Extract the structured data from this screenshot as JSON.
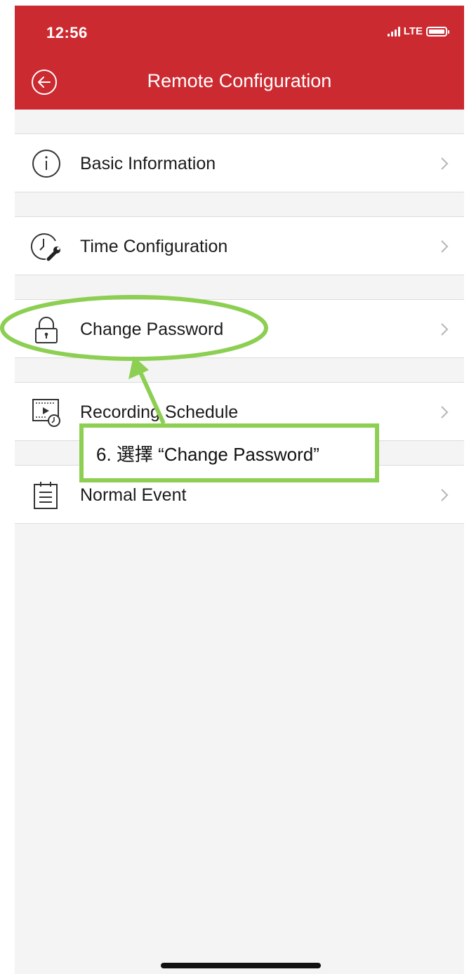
{
  "status_bar": {
    "time": "12:56",
    "network": "LTE"
  },
  "header": {
    "title": "Remote Configuration"
  },
  "menu": {
    "items": [
      {
        "label": "Basic Information",
        "icon": "info-icon"
      },
      {
        "label": "Time Configuration",
        "icon": "time-wrench-icon"
      },
      {
        "label": "Change Password",
        "icon": "lock-icon"
      },
      {
        "label": "Recording Schedule",
        "icon": "recording-schedule-icon"
      },
      {
        "label": "Normal Event",
        "icon": "event-list-icon"
      }
    ]
  },
  "annotation": {
    "text": "6. 選擇 “Change Password”"
  },
  "colors": {
    "header_bg": "#cc2a31",
    "annotation_green": "#8ccf52",
    "page_bg": "#f4f4f4"
  }
}
